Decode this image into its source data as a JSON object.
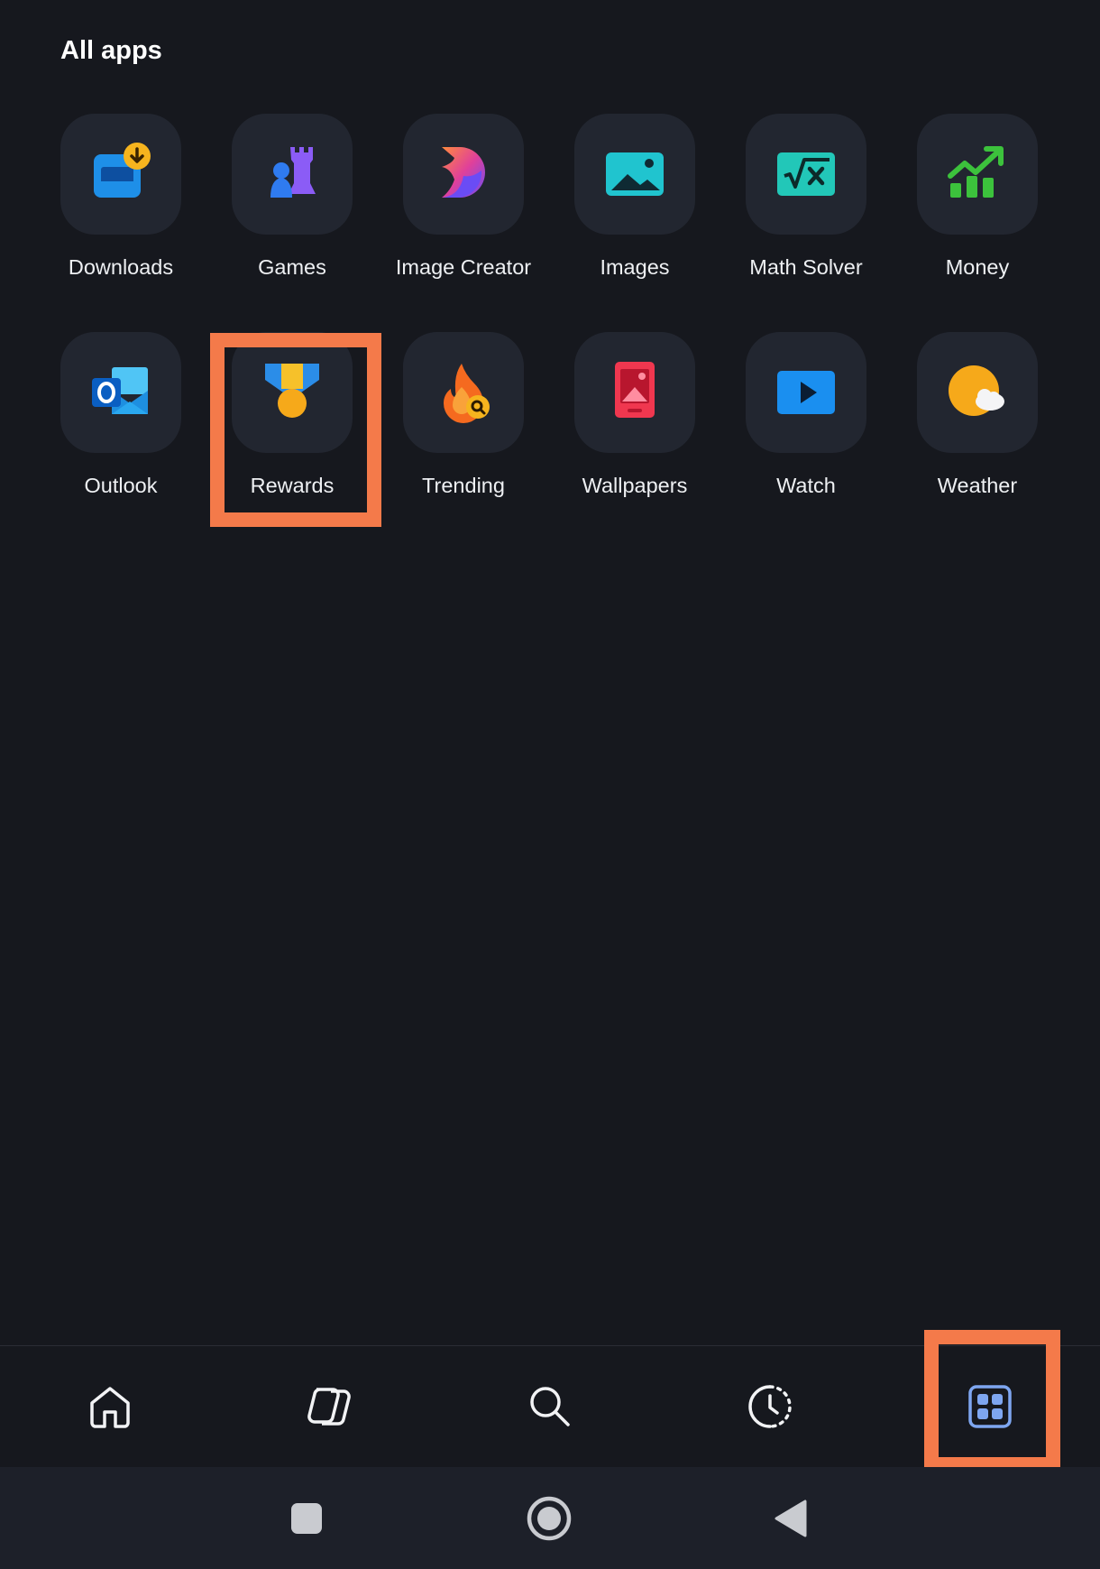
{
  "header": {
    "title": "All apps"
  },
  "apps": [
    {
      "label": "Downloads",
      "icon": "downloads-icon"
    },
    {
      "label": "Games",
      "icon": "games-icon"
    },
    {
      "label": "Image Creator",
      "icon": "image-creator-icon"
    },
    {
      "label": "Images",
      "icon": "images-icon"
    },
    {
      "label": "Math Solver",
      "icon": "math-solver-icon"
    },
    {
      "label": "Money",
      "icon": "money-icon"
    },
    {
      "label": "Outlook",
      "icon": "outlook-icon"
    },
    {
      "label": "Rewards",
      "icon": "rewards-icon"
    },
    {
      "label": "Trending",
      "icon": "trending-icon"
    },
    {
      "label": "Wallpapers",
      "icon": "wallpapers-icon"
    },
    {
      "label": "Watch",
      "icon": "watch-icon"
    },
    {
      "label": "Weather",
      "icon": "weather-icon"
    }
  ],
  "bottom_nav": {
    "items": [
      {
        "icon": "home-icon"
      },
      {
        "icon": "copilot-icon"
      },
      {
        "icon": "search-icon"
      },
      {
        "icon": "history-icon"
      },
      {
        "icon": "apps-grid-icon",
        "selected": true
      }
    ]
  },
  "system_nav": [
    {
      "icon": "recents-square-icon"
    },
    {
      "icon": "home-circle-icon"
    },
    {
      "icon": "back-triangle-icon"
    }
  ],
  "colors": {
    "background": "#16181e",
    "tile": "#222630",
    "highlight": "#f47a4a",
    "active_nav": "#7ea6f0"
  }
}
